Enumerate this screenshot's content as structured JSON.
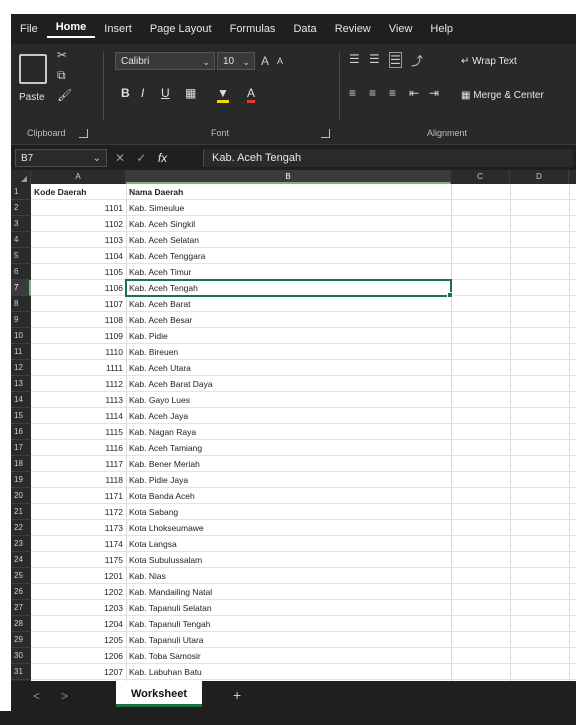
{
  "menu": {
    "tabs": [
      "File",
      "Home",
      "Insert",
      "Page Layout",
      "Formulas",
      "Data",
      "Review",
      "View",
      "Help"
    ],
    "active": "Home"
  },
  "ribbon": {
    "clipboard": {
      "paste_label": "Paste",
      "group_label": "Clipboard"
    },
    "font": {
      "font_name": "Calibri",
      "font_size": "10",
      "grow_label": "A",
      "shrink_label": "A",
      "bold_label": "B",
      "italic_label": "I",
      "underline_label": "U",
      "border_label": "▦",
      "fill_label": "▼",
      "color_label": "A",
      "group_label": "Font"
    },
    "alignment": {
      "wrap_text_label": "Wrap Text",
      "merge_center_label": "Merge & Center",
      "group_label": "Alignment"
    }
  },
  "formula_bar": {
    "name_box": "B7",
    "fx_label": "fx",
    "value": "Kab. Aceh Tengah"
  },
  "columns": [
    "A",
    "B",
    "C",
    "D"
  ],
  "sheet": {
    "headers": {
      "col_a": "Kode Daerah",
      "col_b": "Nama Daerah"
    },
    "rows": [
      {
        "row": "2",
        "kode": "1101",
        "nama": "Kab. Simeulue"
      },
      {
        "row": "3",
        "kode": "1102",
        "nama": "Kab. Aceh Singkil"
      },
      {
        "row": "4",
        "kode": "1103",
        "nama": "Kab. Aceh Selatan"
      },
      {
        "row": "5",
        "kode": "1104",
        "nama": "Kab. Aceh Tenggara"
      },
      {
        "row": "6",
        "kode": "1105",
        "nama": "Kab. Aceh Timur"
      },
      {
        "row": "7",
        "kode": "1106",
        "nama": "Kab. Aceh Tengah"
      },
      {
        "row": "8",
        "kode": "1107",
        "nama": "Kab. Aceh Barat"
      },
      {
        "row": "9",
        "kode": "1108",
        "nama": "Kab. Aceh Besar"
      },
      {
        "row": "10",
        "kode": "1109",
        "nama": "Kab. Pidie"
      },
      {
        "row": "11",
        "kode": "1110",
        "nama": "Kab. Bireuen"
      },
      {
        "row": "12",
        "kode": "1111",
        "nama": "Kab. Aceh Utara"
      },
      {
        "row": "13",
        "kode": "1112",
        "nama": "Kab. Aceh Barat Daya"
      },
      {
        "row": "14",
        "kode": "1113",
        "nama": "Kab. Gayo Lues"
      },
      {
        "row": "15",
        "kode": "1114",
        "nama": "Kab. Aceh Jaya"
      },
      {
        "row": "16",
        "kode": "1115",
        "nama": "Kab. Nagan Raya"
      },
      {
        "row": "17",
        "kode": "1116",
        "nama": "Kab. Aceh Tamiang"
      },
      {
        "row": "18",
        "kode": "1117",
        "nama": "Kab. Bener Meriah"
      },
      {
        "row": "19",
        "kode": "1118",
        "nama": "Kab. Pidie Jaya"
      },
      {
        "row": "20",
        "kode": "1171",
        "nama": "Kota Banda Aceh"
      },
      {
        "row": "21",
        "kode": "1172",
        "nama": "Kota Sabang"
      },
      {
        "row": "22",
        "kode": "1173",
        "nama": "Kota Lhokseumawe"
      },
      {
        "row": "23",
        "kode": "1174",
        "nama": "Kota Langsa"
      },
      {
        "row": "24",
        "kode": "1175",
        "nama": "Kota Subulussalam"
      },
      {
        "row": "25",
        "kode": "1201",
        "nama": "Kab. Nias"
      },
      {
        "row": "26",
        "kode": "1202",
        "nama": "Kab. Mandailing Natal"
      },
      {
        "row": "27",
        "kode": "1203",
        "nama": "Kab. Tapanuli Selatan"
      },
      {
        "row": "28",
        "kode": "1204",
        "nama": "Kab. Tapanuli Tengah"
      },
      {
        "row": "29",
        "kode": "1205",
        "nama": "Kab. Tapanuli Utara"
      },
      {
        "row": "30",
        "kode": "1206",
        "nama": "Kab. Toba Samosir"
      },
      {
        "row": "31",
        "kode": "1207",
        "nama": "Kab. Labuhan Batu"
      }
    ],
    "selected_row": "7"
  },
  "tabs": {
    "sheet_name": "Worksheet",
    "add_label": "+",
    "prev_label": "<",
    "next_label": ">"
  },
  "colors": {
    "accent": "#1e7145",
    "ribbon_bg": "#292929",
    "chrome_bg": "#1f1f1f"
  }
}
